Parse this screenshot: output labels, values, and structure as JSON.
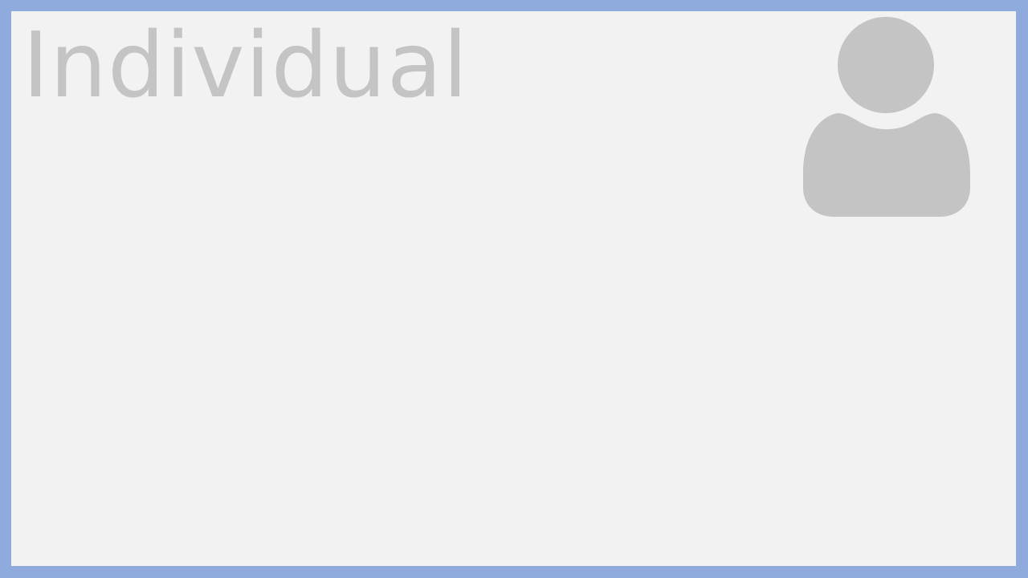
{
  "card": {
    "title": "Individual",
    "icon": "user-avatar-icon"
  },
  "colors": {
    "frame_border": "#8fabdd",
    "panel_background": "#f2f2f2",
    "text_and_icon": "#c4c4c4"
  }
}
